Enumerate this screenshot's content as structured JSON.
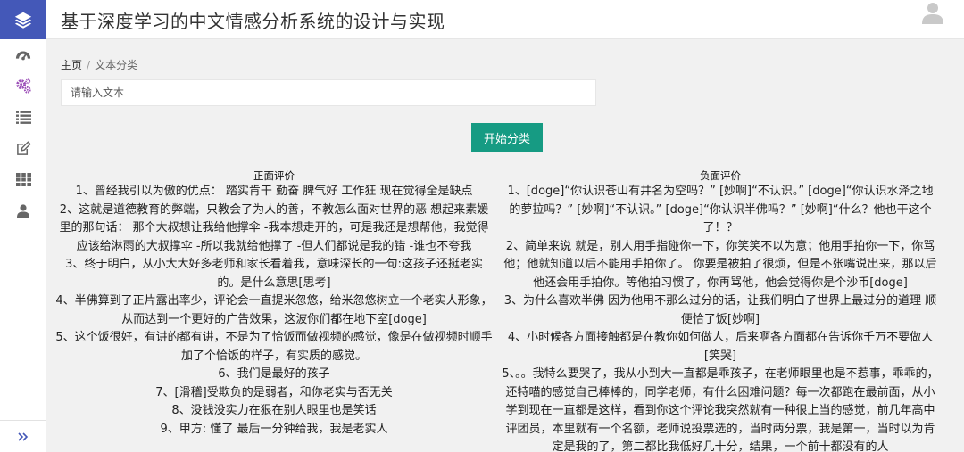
{
  "header": {
    "title": "基于深度学习的中文情感分析系统的设计与实现"
  },
  "sidebar": {
    "items": [
      {
        "icon": "dashboard-icon"
      },
      {
        "icon": "cogs-icon",
        "active": true
      },
      {
        "icon": "list-icon"
      },
      {
        "icon": "edit-icon"
      },
      {
        "icon": "grid-icon"
      },
      {
        "icon": "user-icon"
      }
    ],
    "active_color": "#9c4fb8",
    "icon_color": "#666666",
    "expand_icon": "chevron-double-right-icon"
  },
  "breadcrumb": {
    "home": "主页",
    "separator": "/",
    "current": "文本分类"
  },
  "input": {
    "placeholder": "请输入文本",
    "value": ""
  },
  "classify_button": {
    "label": "开始分类",
    "color": "#169b83"
  },
  "positive": {
    "title": "正面评价",
    "items": [
      "1、曾经我引以为傲的优点： 踏实肯干 勤奋 脾气好 工作狂 现在觉得全是缺点",
      "2、这就是道德教育的弊端，只教会了为人的善，不教怎么面对世界的恶 想起来素媛里的那句话： 那个大叔想让我给他撑伞 -我本想走开的，可是我还是想帮他，我觉得应该给淋雨的大叔撑伞 -所以我就给他撑了 -但人们都说是我的错 -谁也不夸我",
      "3、终于明白，从小大大好多老师和家长看着我，意味深长的一句:这孩子还挺老实的。是什么意思[思考]",
      "4、半佛算到了正片露出率少，评论会一直提米忽悠，给米忽悠树立一个老实人形象，从而达到一个更好的广告效果，这波你们都在地下室[doge]",
      "5、这个饭很好，有讲的都有讲，不是为了恰饭而做视频的感觉，像是在做视频时顺手加了个恰饭的样子，有实质的感觉。",
      "6、我们是最好的孩子",
      "7、[滑稽]受欺负的是弱者，和你老实与否无关",
      "8、没钱没实力在狠在别人眼里也是笑话",
      "9、甲方: 懂了 最后一分钟给我，我是老实人"
    ]
  },
  "negative": {
    "title": "负面评价",
    "items": [
      "1、[doge]“你认识苍山有井名为空吗？” [妙啊]“不认识。” [doge]“你认识水泽之地的萝拉吗？” [妙啊]“不认识。” [doge]“你认识半佛吗？” [妙啊]“什么？他也干这个了！？",
      "2、简单来说 就是，别人用手指碰你一下，你笑笑不以为意；他用手拍你一下，你骂他；他就知道以后不能用手拍你了。 你要是被拍了很烦，但是不张嘴说出来，那以后他还会用手拍你。等他拍习惯了，你再骂他，他会觉得你是个沙币[doge]",
      "3、为什么喜欢半佛 因为他用不那么过分的话，让我们明白了世界上最过分的道理 顺便恰了饭[妙啊]",
      "4、小时候各方面接触都是在教你如何做人，后来啊各方面都在告诉你千万不要做人[笑哭]",
      "5、。。我特么要哭了，我从小到大一直都是乖孩子，在老师眼里也是不惹事，乖乖的，还特喵的感觉自己棒棒的，同学老师，有什么困难问题？每一次都跑在最前面，从小学到现在一直都是这样，看到你这个评论我突然就有一种很上当的感觉，前几年高中评团员，本里就有一个名额，老师说投票选的，当时两分票，我是第一，当时以为肯定是我的了，第二都比我低好几十分，结果，一个前十都没有的人"
    ]
  }
}
